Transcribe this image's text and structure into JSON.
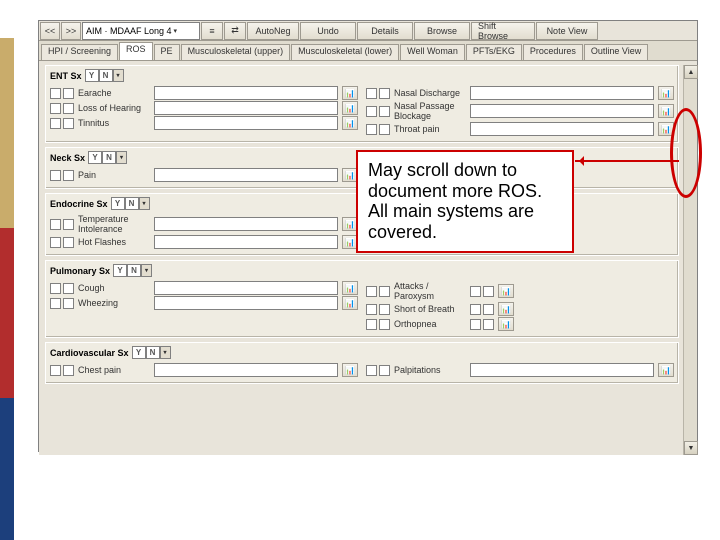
{
  "toolbar": {
    "prev": "<<",
    "next": ">>",
    "template": "AIM · MDAAF Long  4",
    "autoNeg": "AutoNeg",
    "undo": "Undo",
    "details": "Details",
    "browse": "Browse",
    "shiftBrowse": "Shift Browse",
    "noteView": "Note View"
  },
  "tabs": [
    {
      "label": "HPI / Screening"
    },
    {
      "label": "ROS",
      "active": true
    },
    {
      "label": "PE"
    },
    {
      "label": "Musculoskeletal (upper)"
    },
    {
      "label": "Musculoskeletal (lower)"
    },
    {
      "label": "Well Woman"
    },
    {
      "label": "PFTs/EKG"
    },
    {
      "label": "Procedures"
    },
    {
      "label": "Outline View"
    }
  ],
  "yn": {
    "y": "Y",
    "n": "N",
    "dd": "▾"
  },
  "sections": {
    "ent": {
      "title": "ENT Sx",
      "left": [
        "Earache",
        "Loss of Hearing",
        "Tinnitus"
      ],
      "right": [
        "Nasal Discharge",
        "Nasal Passage Blockage",
        "Throat pain"
      ]
    },
    "neck": {
      "title": "Neck Sx",
      "left": [
        "Pain"
      ]
    },
    "endocrine": {
      "title": "Endocrine Sx",
      "left": [
        "Temperature Intolerance",
        "Hot Flashes"
      ]
    },
    "pulmonary": {
      "title": "Pulmonary Sx",
      "left": [
        "Cough",
        "Wheezing"
      ],
      "right": [
        "Attacks / Paroxysm",
        "Short of Breath",
        "Orthopnea"
      ]
    },
    "cardio": {
      "title": "Cardiovascular Sx",
      "left": [
        "Chest pain"
      ],
      "right": [
        "Palpitations"
      ]
    }
  },
  "callout": "May scroll down to document more ROS. All main systems are covered."
}
